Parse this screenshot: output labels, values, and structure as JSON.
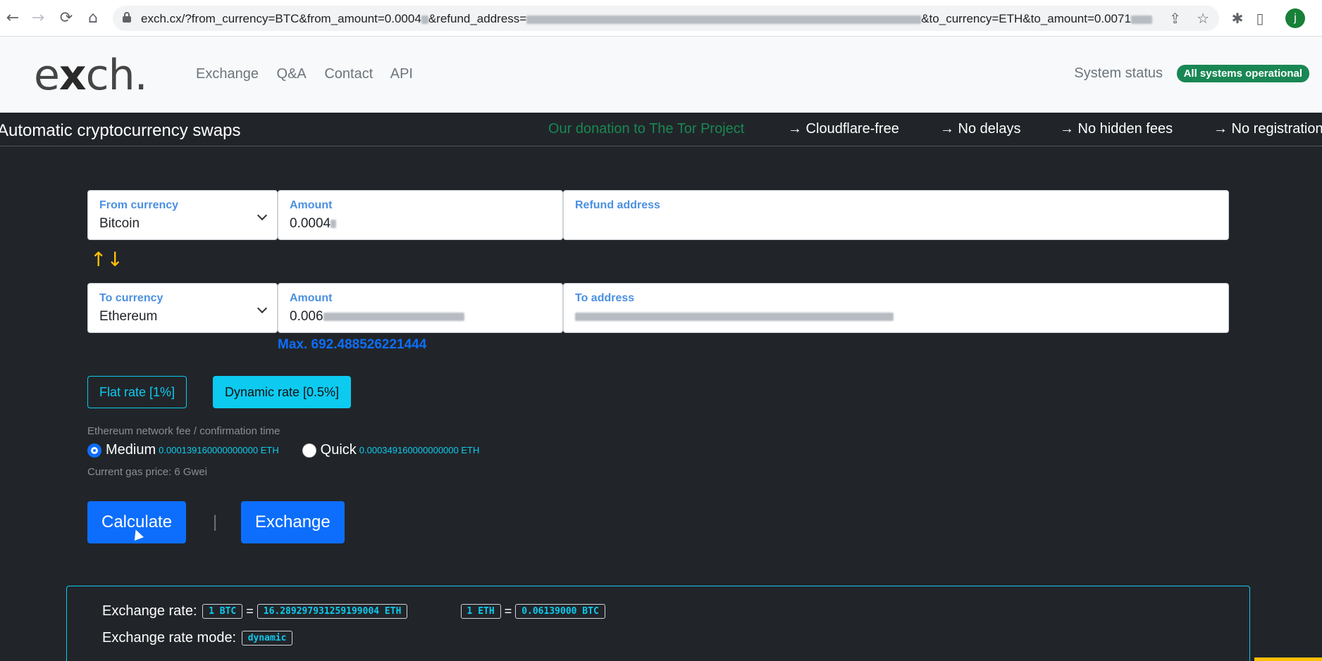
{
  "browser": {
    "url_prefix": "exch.cx/?from_currency=BTC&from_amount=0.0004",
    "url_mid": "&refund_address=",
    "url_suffix": "&to_currency=ETH&to_amount=0.0071",
    "profile_initial": "j"
  },
  "site": {
    "logo_e": "e",
    "logo_x": "x",
    "logo_rest": "ch.",
    "nav": [
      "Exchange",
      "Q&A",
      "Contact",
      "API"
    ],
    "status_label": "System status",
    "status_badge": "All systems operational"
  },
  "strip": {
    "tagline": "Automatic cryptocurrency swaps",
    "donation": "Our donation to The Tor Project",
    "features": [
      "→ Cloudflare-free",
      "→ No delays",
      "→ No hidden fees",
      "→ No registration"
    ]
  },
  "form": {
    "from_currency_label": "From currency",
    "from_currency_value": "Bitcoin",
    "from_amount_label": "Amount",
    "from_amount_value": "0.0004",
    "refund_label": "Refund address",
    "to_currency_label": "To currency",
    "to_currency_value": "Ethereum",
    "to_amount_label": "Amount",
    "to_amount_value": "0.006",
    "to_address_label": "To address",
    "max": "Max. 692.488526221444",
    "flat_rate": "Flat rate [1%]",
    "dynamic_rate": "Dynamic rate [0.5%]",
    "fee_title": "Ethereum network fee / confirmation time",
    "medium_label": "Medium",
    "medium_fee": "0.000139160000000000 ETH",
    "quick_label": "Quick",
    "quick_fee": "0.000349160000000000 ETH",
    "gas_price": "Current gas price: 6 Gwei",
    "calculate": "Calculate",
    "separator": "|",
    "exchange": "Exchange"
  },
  "rates": {
    "rate_label": "Exchange rate:",
    "btc_unit": "1 BTC",
    "eq": "=",
    "btc_in_eth": "16.289297931259199004 ETH",
    "eth_unit": "1 ETH",
    "eth_in_btc": "0.06139000 BTC",
    "mode_label": "Exchange rate mode:",
    "mode_value": "dynamic"
  },
  "colors": {
    "accent_cyan": "#0dcaf0",
    "primary_blue": "#0d6efd",
    "success_green": "#198754",
    "swap_icon_yellow": "#ffc107"
  },
  "icons": [
    "back-icon",
    "forward-icon",
    "reload-icon",
    "home-icon",
    "lock-icon",
    "share-icon",
    "star-icon",
    "extensions-icon",
    "sidepanel-icon",
    "swap-arrows-icon",
    "chevron-down-icon"
  ]
}
